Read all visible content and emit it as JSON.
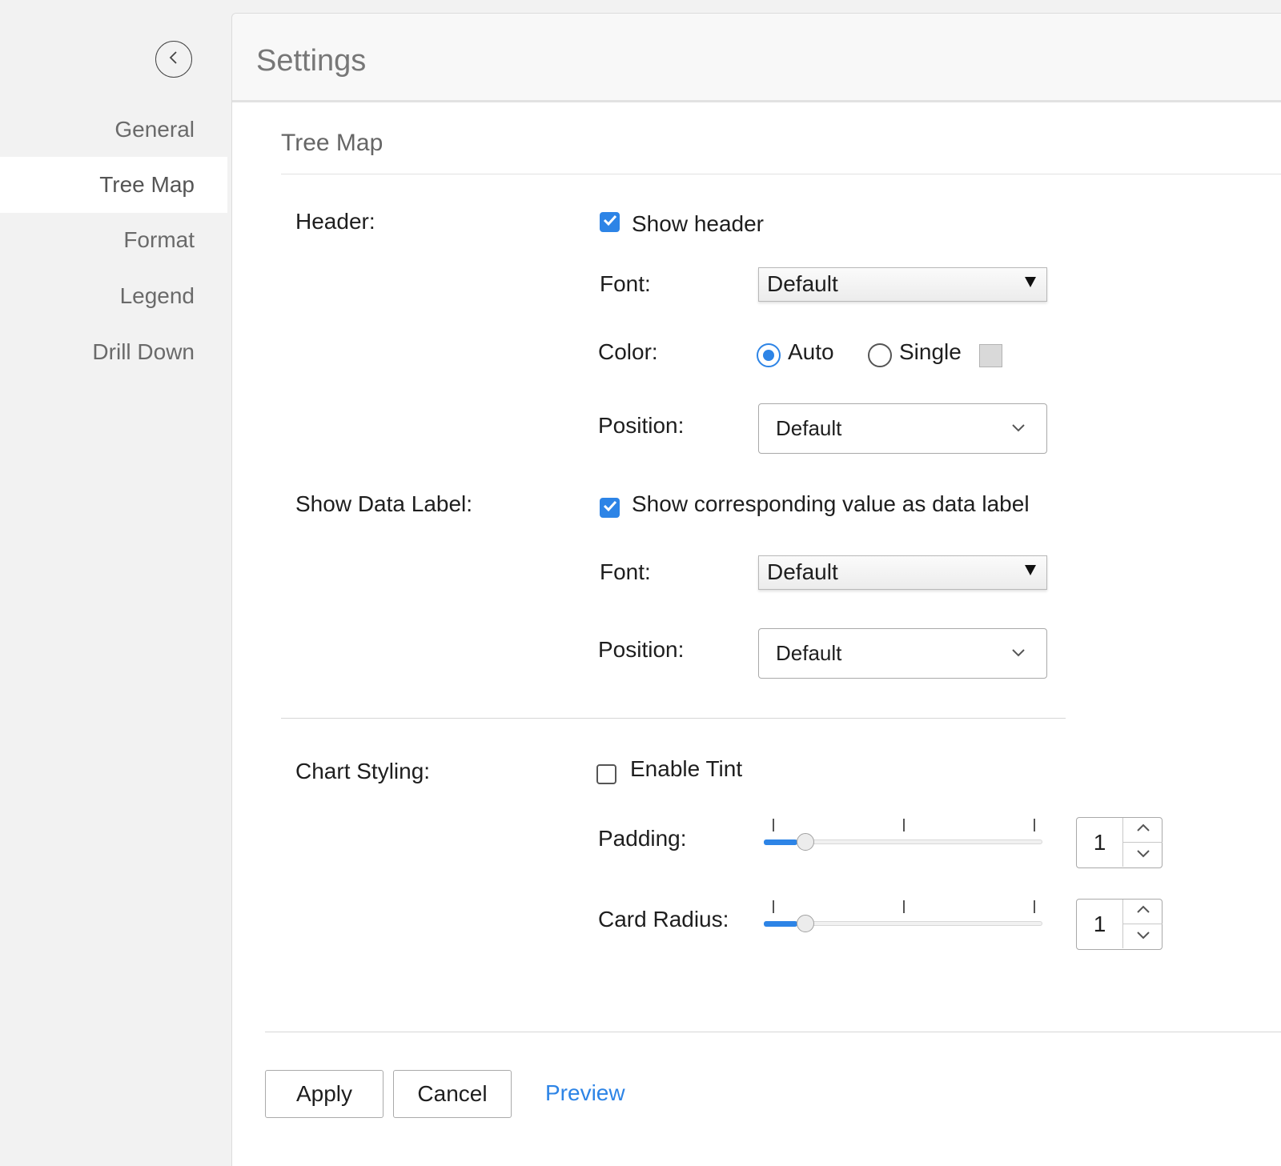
{
  "sidebar": {
    "items": [
      {
        "label": "General"
      },
      {
        "label": "Tree Map"
      },
      {
        "label": "Format"
      },
      {
        "label": "Legend"
      },
      {
        "label": "Drill Down"
      }
    ],
    "active": "Tree Map"
  },
  "page": {
    "title": "Settings"
  },
  "section": {
    "title": "Tree Map"
  },
  "header": {
    "label": "Header:",
    "show_header": {
      "label": "Show header",
      "checked": true
    },
    "font": {
      "label": "Font:",
      "value": "Default"
    },
    "color": {
      "label": "Color:",
      "options": [
        "Auto",
        "Single"
      ],
      "selected": "Auto",
      "swatch_color": "#d9d9d9"
    },
    "position": {
      "label": "Position:",
      "value": "Default"
    }
  },
  "data_label": {
    "label": "Show Data Label:",
    "show_value": {
      "label": "Show corresponding value as data label",
      "checked": true
    },
    "font": {
      "label": "Font:",
      "value": "Default"
    },
    "position": {
      "label": "Position:",
      "value": "Default"
    }
  },
  "chart_styling": {
    "label": "Chart Styling:",
    "enable_tint": {
      "label": "Enable Tint",
      "checked": false
    },
    "padding": {
      "label": "Padding:",
      "value": "1"
    },
    "card_radius": {
      "label": "Card Radius:",
      "value": "1"
    }
  },
  "footer": {
    "apply_label": "Apply",
    "cancel_label": "Cancel",
    "preview_label": "Preview"
  },
  "colors": {
    "accent": "#2d84e6"
  }
}
